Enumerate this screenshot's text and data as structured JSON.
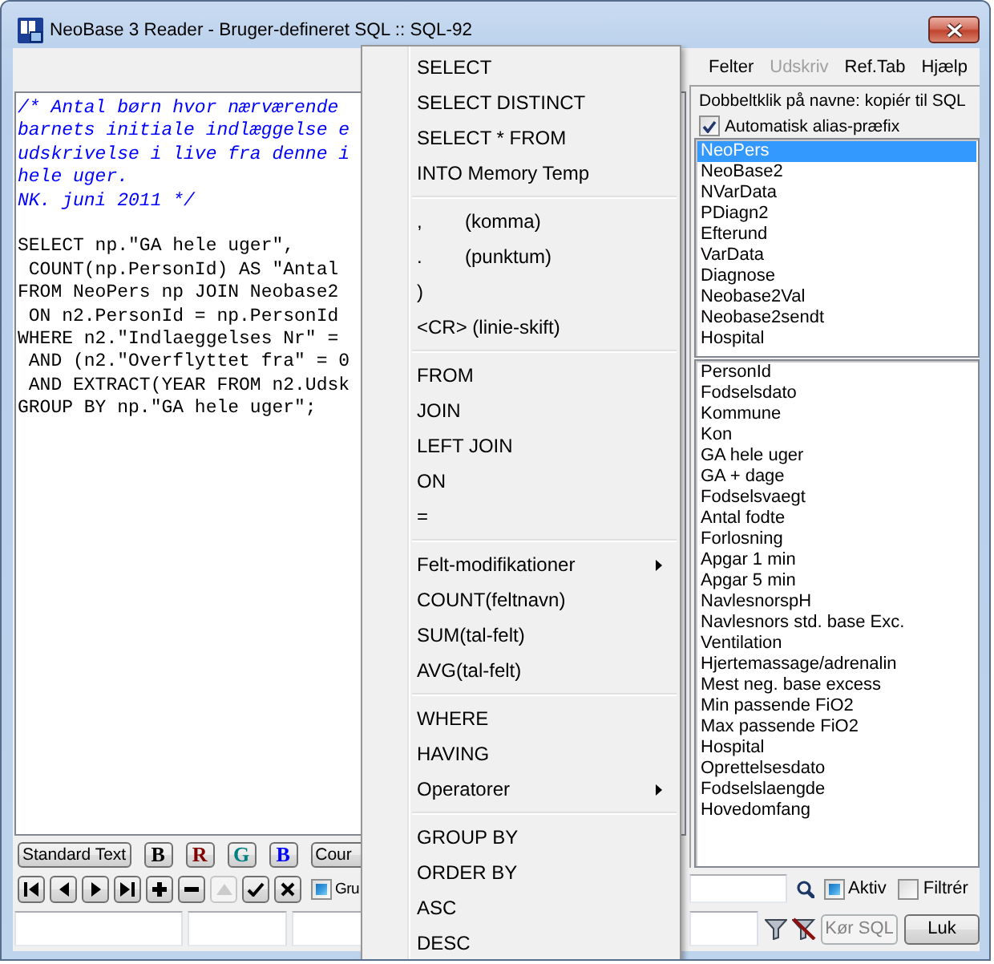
{
  "window": {
    "title": "NeoBase 3 Reader - Bruger-defineret SQL :: SQL-92"
  },
  "editor": {
    "lines": [
      {
        "kind": "comment",
        "text": "/* Antal børn hvor nærværende"
      },
      {
        "kind": "comment",
        "text": "barnets initiale indlæggelse e"
      },
      {
        "kind": "comment",
        "text": "udskrivelse i live fra denne i"
      },
      {
        "kind": "comment",
        "text": "hele uger."
      },
      {
        "kind": "comment",
        "text": "NK. juni 2011 */"
      },
      {
        "kind": "blank"
      },
      {
        "kind": "code",
        "text": "SELECT np.\"GA hele uger\","
      },
      {
        "kind": "code",
        "text": " COUNT(np.PersonId) AS \"Antal"
      },
      {
        "kind": "code",
        "text": "FROM NeoPers np JOIN Neobase2"
      },
      {
        "kind": "code",
        "text": " ON n2.PersonId = np.PersonId"
      },
      {
        "kind": "code",
        "text": "WHERE n2.\"Indlaeggelses Nr\" ="
      },
      {
        "kind": "code",
        "text": " AND (n2.\"Overflyttet fra\" = 0"
      },
      {
        "kind": "code",
        "text": " AND EXTRACT(YEAR FROM n2.Udsk"
      },
      {
        "kind": "code",
        "text": "GROUP BY np.\"GA hele uger\";"
      }
    ]
  },
  "format_buttons": [
    {
      "kind": "text",
      "label": "Standard Text"
    },
    {
      "kind": "color",
      "label": "B",
      "color": "#000000"
    },
    {
      "kind": "color",
      "label": "R",
      "color": "#800000"
    },
    {
      "kind": "color",
      "label": "G",
      "color": "#008080"
    },
    {
      "kind": "color",
      "label": "B",
      "color": "#0000ff"
    },
    {
      "kind": "text",
      "label": "Cour"
    }
  ],
  "navigator": [
    {
      "kind": "first",
      "disabled": false
    },
    {
      "kind": "prior",
      "disabled": false
    },
    {
      "kind": "next",
      "disabled": false
    },
    {
      "kind": "last",
      "disabled": false
    },
    {
      "kind": "insert",
      "disabled": false
    },
    {
      "kind": "delete",
      "disabled": false
    },
    {
      "kind": "edit",
      "disabled": true
    },
    {
      "kind": "post",
      "disabled": false
    },
    {
      "kind": "cancel",
      "disabled": false
    }
  ],
  "group_checkbox": {
    "label": "Gru",
    "checked": false,
    "indeterminate": true
  },
  "menubar": [
    {
      "label": "Felter",
      "disabled": false
    },
    {
      "label": "Udskriv",
      "disabled": true
    },
    {
      "label": "Ref.Tab",
      "disabled": false
    },
    {
      "label": "Hjælp",
      "disabled": false
    }
  ],
  "panel": {
    "hint": "Dobbeltklik på navne: kopiér til SQL",
    "alias_checkbox": {
      "label": "Automatisk alias-præfix",
      "checked": true
    },
    "tables": [
      {
        "label": "NeoPers",
        "selected": true
      },
      {
        "label": "NeoBase2",
        "selected": false
      },
      {
        "label": "NVarData",
        "selected": false
      },
      {
        "label": "PDiagn2",
        "selected": false
      },
      {
        "label": "Efterund",
        "selected": false
      },
      {
        "label": "VarData",
        "selected": false
      },
      {
        "label": "Diagnose",
        "selected": false
      },
      {
        "label": "Neobase2Val",
        "selected": false
      },
      {
        "label": "Neobase2sendt",
        "selected": false
      },
      {
        "label": "Hospital",
        "selected": false
      }
    ],
    "fields": [
      {
        "label": "PersonId",
        "selected": false
      },
      {
        "label": "Fodselsdato",
        "selected": false
      },
      {
        "label": "Kommune",
        "selected": false
      },
      {
        "label": "Kon",
        "selected": false
      },
      {
        "label": "GA hele uger",
        "selected": false
      },
      {
        "label": "GA + dage",
        "selected": false
      },
      {
        "label": "Fodselsvaegt",
        "selected": false
      },
      {
        "label": "Antal fodte",
        "selected": false
      },
      {
        "label": "Forlosning",
        "selected": false
      },
      {
        "label": "Apgar 1 min",
        "selected": false
      },
      {
        "label": "Apgar 5 min",
        "selected": false
      },
      {
        "label": "NavlesnorspH",
        "selected": false
      },
      {
        "label": "Navlesnors std. base Exc.",
        "selected": false
      },
      {
        "label": "Ventilation",
        "selected": false
      },
      {
        "label": "Hjertemassage/adrenalin",
        "selected": false
      },
      {
        "label": "Mest neg. base excess",
        "selected": false
      },
      {
        "label": "Min passende FiO2",
        "selected": false
      },
      {
        "label": "Max passende FiO2",
        "selected": false
      },
      {
        "label": "Hospital",
        "selected": false
      },
      {
        "label": "Oprettelsesdato",
        "selected": false
      },
      {
        "label": "Fodselslaengde",
        "selected": false
      },
      {
        "label": "Hovedomfang",
        "selected": false
      }
    ]
  },
  "active_checkbox": {
    "label": "Aktiv",
    "checked": false,
    "indeterminate": true
  },
  "filter_checkbox": {
    "label": "Filtrér",
    "checked": false,
    "indeterminate": false
  },
  "buttons": [
    {
      "kind": "push",
      "label": "Kør SQL",
      "disabled": true
    },
    {
      "kind": "push",
      "label": "Luk",
      "disabled": false
    }
  ],
  "context_menu": {
    "items": [
      {
        "kind": "item",
        "label": "SELECT"
      },
      {
        "kind": "item",
        "label": "SELECT DISTINCT"
      },
      {
        "kind": "item",
        "label": "SELECT * FROM"
      },
      {
        "kind": "item",
        "label": "INTO Memory Temp"
      },
      {
        "kind": "separator"
      },
      {
        "kind": "item",
        "label": ",",
        "note": "(komma)"
      },
      {
        "kind": "item",
        "label": ".",
        "note": "(punktum)"
      },
      {
        "kind": "item",
        "label": ")"
      },
      {
        "kind": "item",
        "label": "<CR> (linie-skift)"
      },
      {
        "kind": "separator"
      },
      {
        "kind": "item",
        "label": "FROM"
      },
      {
        "kind": "item",
        "label": "JOIN"
      },
      {
        "kind": "item",
        "label": "LEFT JOIN"
      },
      {
        "kind": "item",
        "label": "ON"
      },
      {
        "kind": "item",
        "label": "="
      },
      {
        "kind": "separator"
      },
      {
        "kind": "submenu",
        "label": "Felt-modifikationer"
      },
      {
        "kind": "item",
        "label": "COUNT(feltnavn)"
      },
      {
        "kind": "item",
        "label": "SUM(tal-felt)"
      },
      {
        "kind": "item",
        "label": "AVG(tal-felt)"
      },
      {
        "kind": "separator"
      },
      {
        "kind": "item",
        "label": "WHERE"
      },
      {
        "kind": "item",
        "label": "HAVING"
      },
      {
        "kind": "submenu",
        "label": "Operatorer"
      },
      {
        "kind": "separator"
      },
      {
        "kind": "item",
        "label": "GROUP BY"
      },
      {
        "kind": "item",
        "label": "ORDER BY"
      },
      {
        "kind": "item",
        "label": "ASC"
      },
      {
        "kind": "item",
        "label": "DESC"
      }
    ]
  }
}
